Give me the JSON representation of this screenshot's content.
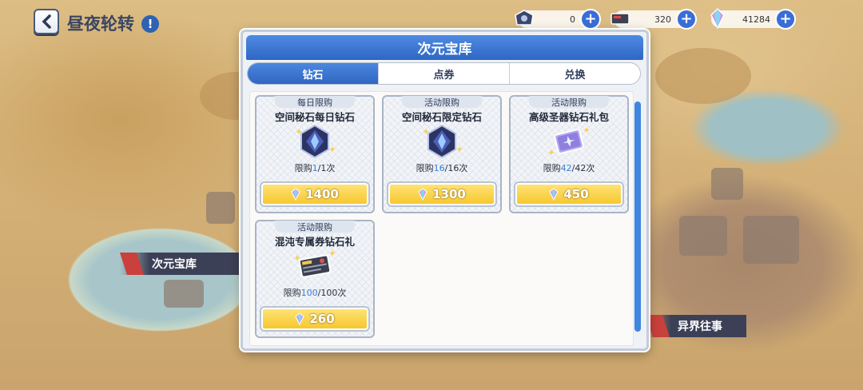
{
  "header": {
    "title": "昼夜轮转",
    "info_symbol": "!"
  },
  "currencies": [
    {
      "name": "ticket-currency",
      "value": "0"
    },
    {
      "name": "voucher-currency",
      "value": "320"
    },
    {
      "name": "diamond-currency",
      "value": "41284"
    }
  ],
  "map_labels": {
    "left": "次元宝库",
    "right": "异界往事"
  },
  "dialog": {
    "title": "次元宝库",
    "tabs": [
      {
        "label": "钻石",
        "active": true
      },
      {
        "label": "点券",
        "active": false
      },
      {
        "label": "兑换",
        "active": false
      }
    ],
    "items": [
      {
        "tag": "每日限购",
        "name": "空间秘石每日钻石",
        "limit_prefix": "限购",
        "used": "1",
        "total": "/1次",
        "price": "1400",
        "icon": "crystal-icon"
      },
      {
        "tag": "活动限购",
        "name": "空间秘石限定钻石",
        "limit_prefix": "限购",
        "used": "16",
        "total": "/16次",
        "price": "1300",
        "icon": "crystal-icon"
      },
      {
        "tag": "活动限购",
        "name": "高级圣器钻石礼包",
        "limit_prefix": "限购",
        "used": "42",
        "total": "/42次",
        "price": "450",
        "icon": "relic-card-icon"
      },
      {
        "tag": "活动限购",
        "name": "混沌专属券钻石礼",
        "limit_prefix": "限购",
        "used": "100",
        "total": "/100次",
        "price": "260",
        "icon": "ticket-card-icon"
      }
    ]
  },
  "colors": {
    "accent_blue": "#2f66c2",
    "price_gold": "#f6c52a",
    "limit_used": "#3a7ed6"
  }
}
